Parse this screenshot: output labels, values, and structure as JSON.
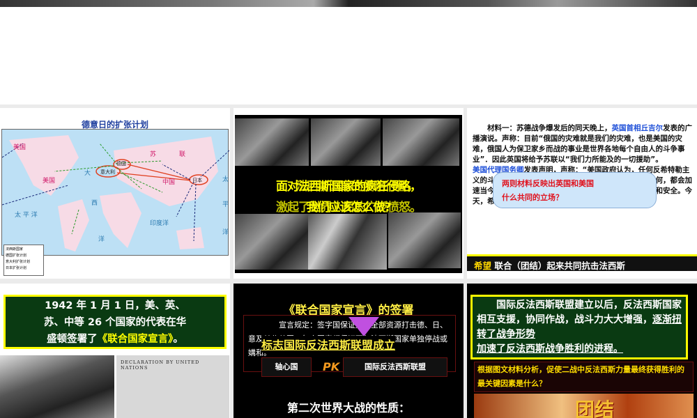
{
  "slides": [
    {
      "title": "德意日的扩张计划",
      "map_labels": {
        "usa_north": "美国",
        "usa": "美国",
        "ussr_1": "苏",
        "ussr_2": "联",
        "germany": "德国",
        "italy": "意大利",
        "china": "中国",
        "japan": "日本",
        "pacific": "太 平 洋",
        "atlantic_1": "大",
        "atlantic_2": "西",
        "atlantic_3": "洋",
        "indian": "印度洋",
        "pacific_e1": "太",
        "pacific_e2": "平",
        "pacific_e3": "洋"
      },
      "legend": [
        "法西斯国家",
        "德国扩张计划",
        "意大利扩张计划",
        "日本扩张计划"
      ]
    },
    {
      "line1": "面对法西斯国家的疯狂侵略，",
      "line2": "我们应该怎么做?",
      "overlay1": "法西斯国家的侵略行径，",
      "overlay2": "激起了世界人民的广泛愤怒。"
    },
    {
      "text_a_pre": "材料一：苏德战争爆发后的同天晚上，",
      "text_a_blue": "英国首相丘吉尔",
      "text_a_post": "发表的广播演说。声称：目前“俄国的灾难就是我们的灾难，也是美国的灾难，俄国人为保卫家乡而战的事业是世界各地每个自由人的斗争事业”．因此英国将给予苏联以“我们力所能及的一切援助”。",
      "text_b_blue": "美国代理国务卿",
      "text_b_post": "发表声明，声称：“美国政府认为，任何反希特勒主义的斗争，任何反希特勒主义力量的团结，不论其来历如何，都会加速当今德国统治者必然败亡的进程，从而促进美国的国防和安全。今天，希特勒军队是美洲大陆的主要危险。”",
      "bubble_1": "两则材料反映出英国和美国",
      "bubble_2": "什么共同的立场？",
      "banner_hl": "希望",
      "banner_rest": " 联合（团结）起来共同抗击法西斯"
    },
    {
      "line1": "1942 年 1 月 1 日，美、英、",
      "line2": "苏、中等 26 个国家的代表在华",
      "line3_pre": "盛顿签署了",
      "line3_hl": "《联合国家宣言》",
      "line3_post": "。",
      "doc_title": "DECLARATION BY UNITED NATIONS"
    },
    {
      "title": "《联合国家宣言》的签署",
      "body": "宣言规定：签字国保证运用全部资源打击德、日、意及其仆从国；每个国家都保证不与法西斯国家单独停战或媾和。",
      "mark": "标志国际反法西斯联盟成立",
      "axis": "轴心国",
      "pk": "PK",
      "allies": "国际反法西斯联盟",
      "nature": "第二次世界大战的性质："
    },
    {
      "p_pre": "国际反法西斯联盟建立以后，反法西斯国家相互支援，协同作战，战斗力大大增强，",
      "p_ul1": "逐渐扭转了战争形势",
      "p_ul2": "加速了反法西斯战争胜利的进程。",
      "question": "根据图文材料分析，促使二战中反法西斯力量最终获得胜利的最关键因素是什么？",
      "image_text": "团结"
    }
  ],
  "colors": {
    "green_box": "#0a3a12",
    "yellow": "#ffff00",
    "blue_text": "#1e4fd8",
    "red_text": "#e0131e"
  }
}
